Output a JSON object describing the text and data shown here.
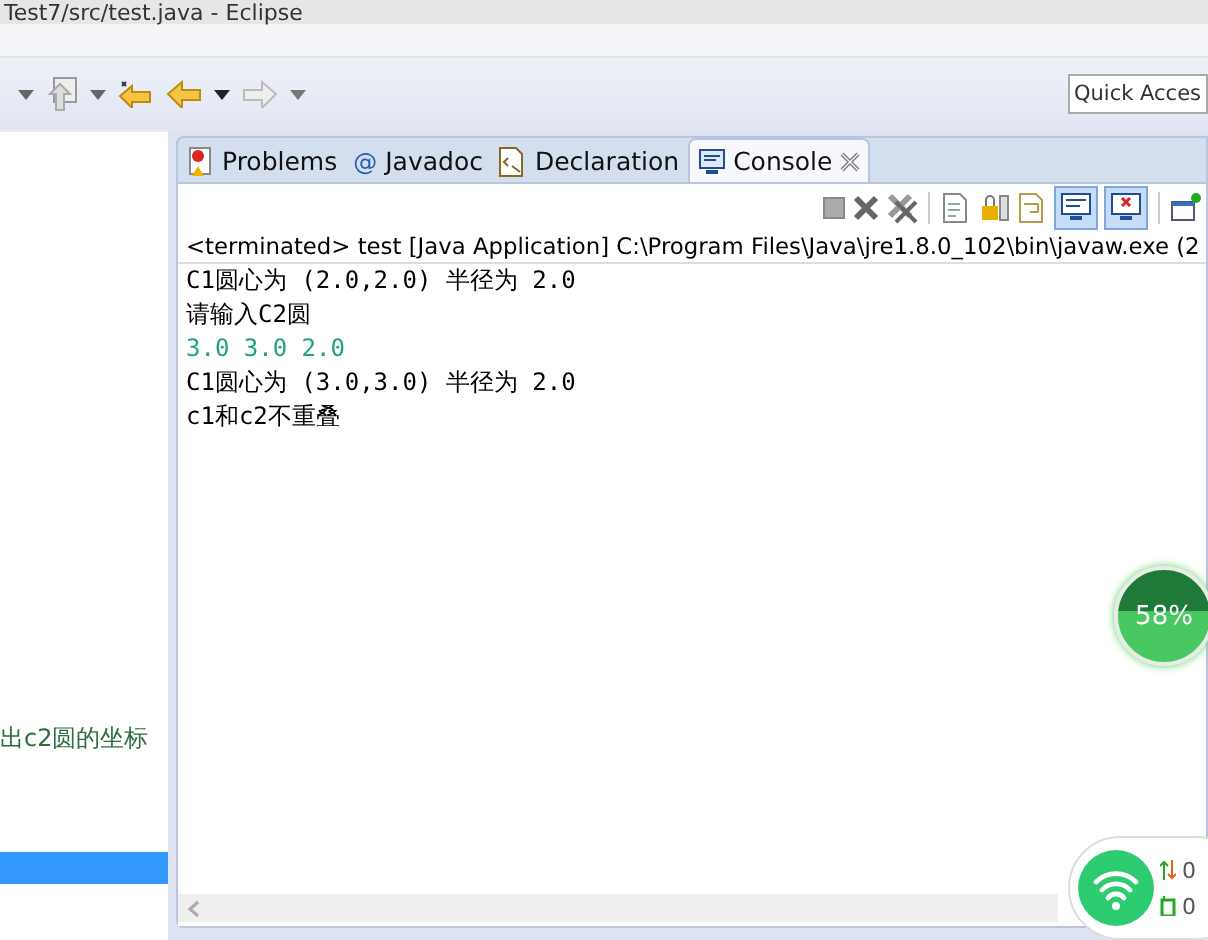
{
  "window": {
    "title": "Test7/src/test.java - Eclipse"
  },
  "quick_access": {
    "placeholder": "Quick Acces"
  },
  "left_panel": {
    "text": "出c2圆的坐标"
  },
  "tabs": [
    {
      "label": "Problems",
      "selected": false
    },
    {
      "label": "Javadoc",
      "symbol": "@",
      "selected": false
    },
    {
      "label": "Declaration",
      "selected": false
    },
    {
      "label": "Console",
      "selected": true
    }
  ],
  "console": {
    "header": "<terminated> test [Java Application] C:\\Program Files\\Java\\jre1.8.0_102\\bin\\javaw.exe (2",
    "lines": [
      {
        "text": "C1圆心为 (2.0,2.0) 半径为 2.0",
        "kind": "output"
      },
      {
        "text": "请输入C2圆",
        "kind": "output"
      },
      {
        "text": "3.0 3.0 2.0",
        "kind": "input"
      },
      {
        "text": "C1圆心为 (3.0,3.0) 半径为 2.0",
        "kind": "output"
      },
      {
        "text": "c1和c2不重叠",
        "kind": "output"
      }
    ]
  },
  "memory_ball": {
    "text": "58%"
  },
  "network_widget": {
    "upload": "0",
    "download": "0"
  }
}
